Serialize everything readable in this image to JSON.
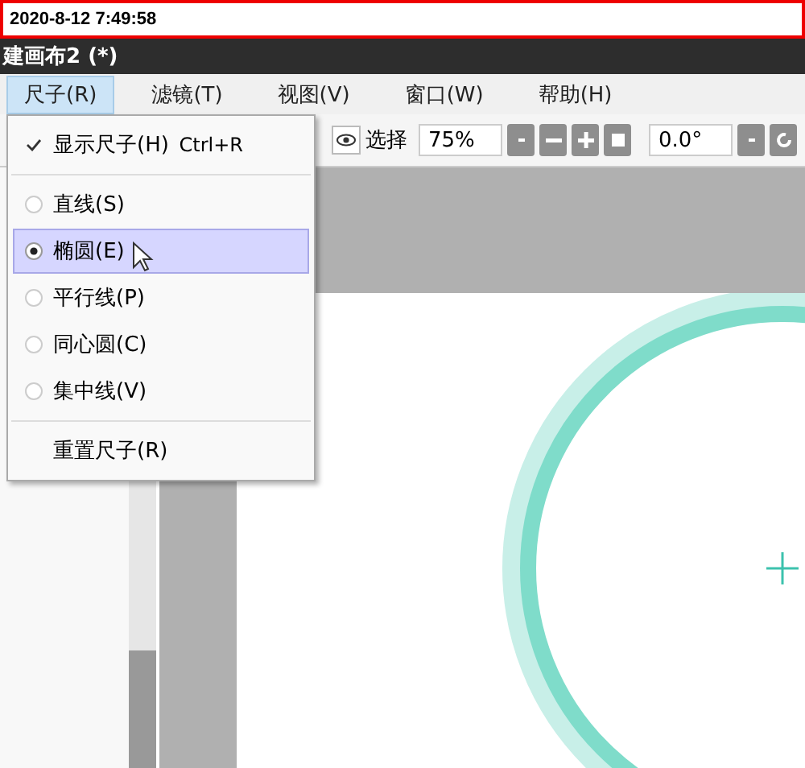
{
  "timestamp": "2020-8-12 7:49:58",
  "window": {
    "title": "建画布2 (*)"
  },
  "menu_bar": [
    {
      "label": "尺子(R)",
      "selected": true
    },
    {
      "label": "滤镜(T)",
      "selected": false
    },
    {
      "label": "视图(V)",
      "selected": false
    },
    {
      "label": "窗口(W)",
      "selected": false
    },
    {
      "label": "帮助(H)",
      "selected": false
    }
  ],
  "toolbar": {
    "select_label": "选择",
    "zoom": "75%",
    "angle": "0.0°"
  },
  "dropdown": [
    {
      "kind": "check",
      "label": "显示尺子(H)",
      "shortcut": "Ctrl+R",
      "checked": true
    },
    {
      "kind": "separator"
    },
    {
      "kind": "radio",
      "label": "直线(S)",
      "selected": false
    },
    {
      "kind": "radio",
      "label": "椭圆(E)",
      "selected": true
    },
    {
      "kind": "radio",
      "label": "平行线(P)",
      "selected": false
    },
    {
      "kind": "radio",
      "label": "同心圆(C)",
      "selected": false
    },
    {
      "kind": "radio",
      "label": "集中线(V)",
      "selected": false
    },
    {
      "kind": "separator"
    },
    {
      "kind": "plain",
      "label": "重置尺子(R)"
    }
  ]
}
